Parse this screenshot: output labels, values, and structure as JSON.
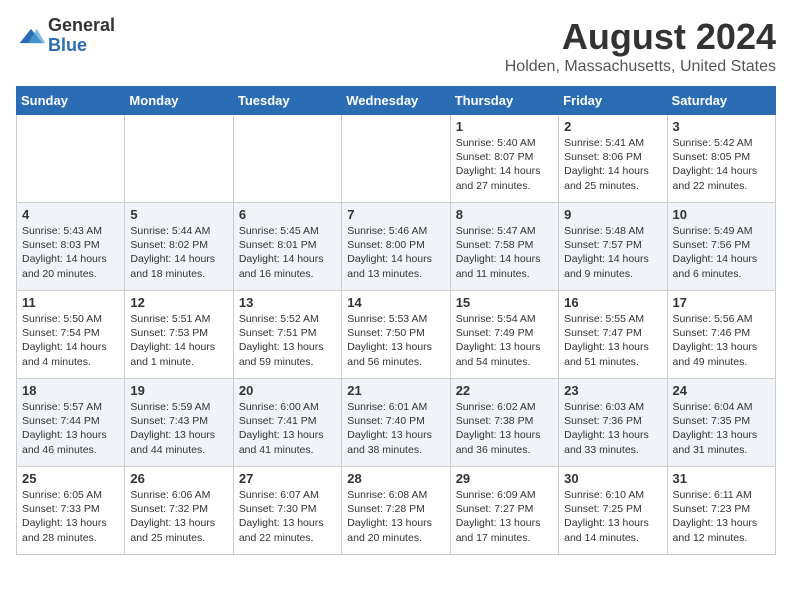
{
  "header": {
    "logo_general": "General",
    "logo_blue": "Blue",
    "month": "August 2024",
    "location": "Holden, Massachusetts, United States"
  },
  "days_of_week": [
    "Sunday",
    "Monday",
    "Tuesday",
    "Wednesday",
    "Thursday",
    "Friday",
    "Saturday"
  ],
  "weeks": [
    [
      {
        "day": "",
        "content": ""
      },
      {
        "day": "",
        "content": ""
      },
      {
        "day": "",
        "content": ""
      },
      {
        "day": "",
        "content": ""
      },
      {
        "day": "1",
        "content": "Sunrise: 5:40 AM\nSunset: 8:07 PM\nDaylight: 14 hours\nand 27 minutes."
      },
      {
        "day": "2",
        "content": "Sunrise: 5:41 AM\nSunset: 8:06 PM\nDaylight: 14 hours\nand 25 minutes."
      },
      {
        "day": "3",
        "content": "Sunrise: 5:42 AM\nSunset: 8:05 PM\nDaylight: 14 hours\nand 22 minutes."
      }
    ],
    [
      {
        "day": "4",
        "content": "Sunrise: 5:43 AM\nSunset: 8:03 PM\nDaylight: 14 hours\nand 20 minutes."
      },
      {
        "day": "5",
        "content": "Sunrise: 5:44 AM\nSunset: 8:02 PM\nDaylight: 14 hours\nand 18 minutes."
      },
      {
        "day": "6",
        "content": "Sunrise: 5:45 AM\nSunset: 8:01 PM\nDaylight: 14 hours\nand 16 minutes."
      },
      {
        "day": "7",
        "content": "Sunrise: 5:46 AM\nSunset: 8:00 PM\nDaylight: 14 hours\nand 13 minutes."
      },
      {
        "day": "8",
        "content": "Sunrise: 5:47 AM\nSunset: 7:58 PM\nDaylight: 14 hours\nand 11 minutes."
      },
      {
        "day": "9",
        "content": "Sunrise: 5:48 AM\nSunset: 7:57 PM\nDaylight: 14 hours\nand 9 minutes."
      },
      {
        "day": "10",
        "content": "Sunrise: 5:49 AM\nSunset: 7:56 PM\nDaylight: 14 hours\nand 6 minutes."
      }
    ],
    [
      {
        "day": "11",
        "content": "Sunrise: 5:50 AM\nSunset: 7:54 PM\nDaylight: 14 hours\nand 4 minutes."
      },
      {
        "day": "12",
        "content": "Sunrise: 5:51 AM\nSunset: 7:53 PM\nDaylight: 14 hours\nand 1 minute."
      },
      {
        "day": "13",
        "content": "Sunrise: 5:52 AM\nSunset: 7:51 PM\nDaylight: 13 hours\nand 59 minutes."
      },
      {
        "day": "14",
        "content": "Sunrise: 5:53 AM\nSunset: 7:50 PM\nDaylight: 13 hours\nand 56 minutes."
      },
      {
        "day": "15",
        "content": "Sunrise: 5:54 AM\nSunset: 7:49 PM\nDaylight: 13 hours\nand 54 minutes."
      },
      {
        "day": "16",
        "content": "Sunrise: 5:55 AM\nSunset: 7:47 PM\nDaylight: 13 hours\nand 51 minutes."
      },
      {
        "day": "17",
        "content": "Sunrise: 5:56 AM\nSunset: 7:46 PM\nDaylight: 13 hours\nand 49 minutes."
      }
    ],
    [
      {
        "day": "18",
        "content": "Sunrise: 5:57 AM\nSunset: 7:44 PM\nDaylight: 13 hours\nand 46 minutes."
      },
      {
        "day": "19",
        "content": "Sunrise: 5:59 AM\nSunset: 7:43 PM\nDaylight: 13 hours\nand 44 minutes."
      },
      {
        "day": "20",
        "content": "Sunrise: 6:00 AM\nSunset: 7:41 PM\nDaylight: 13 hours\nand 41 minutes."
      },
      {
        "day": "21",
        "content": "Sunrise: 6:01 AM\nSunset: 7:40 PM\nDaylight: 13 hours\nand 38 minutes."
      },
      {
        "day": "22",
        "content": "Sunrise: 6:02 AM\nSunset: 7:38 PM\nDaylight: 13 hours\nand 36 minutes."
      },
      {
        "day": "23",
        "content": "Sunrise: 6:03 AM\nSunset: 7:36 PM\nDaylight: 13 hours\nand 33 minutes."
      },
      {
        "day": "24",
        "content": "Sunrise: 6:04 AM\nSunset: 7:35 PM\nDaylight: 13 hours\nand 31 minutes."
      }
    ],
    [
      {
        "day": "25",
        "content": "Sunrise: 6:05 AM\nSunset: 7:33 PM\nDaylight: 13 hours\nand 28 minutes."
      },
      {
        "day": "26",
        "content": "Sunrise: 6:06 AM\nSunset: 7:32 PM\nDaylight: 13 hours\nand 25 minutes."
      },
      {
        "day": "27",
        "content": "Sunrise: 6:07 AM\nSunset: 7:30 PM\nDaylight: 13 hours\nand 22 minutes."
      },
      {
        "day": "28",
        "content": "Sunrise: 6:08 AM\nSunset: 7:28 PM\nDaylight: 13 hours\nand 20 minutes."
      },
      {
        "day": "29",
        "content": "Sunrise: 6:09 AM\nSunset: 7:27 PM\nDaylight: 13 hours\nand 17 minutes."
      },
      {
        "day": "30",
        "content": "Sunrise: 6:10 AM\nSunset: 7:25 PM\nDaylight: 13 hours\nand 14 minutes."
      },
      {
        "day": "31",
        "content": "Sunrise: 6:11 AM\nSunset: 7:23 PM\nDaylight: 13 hours\nand 12 minutes."
      }
    ]
  ]
}
